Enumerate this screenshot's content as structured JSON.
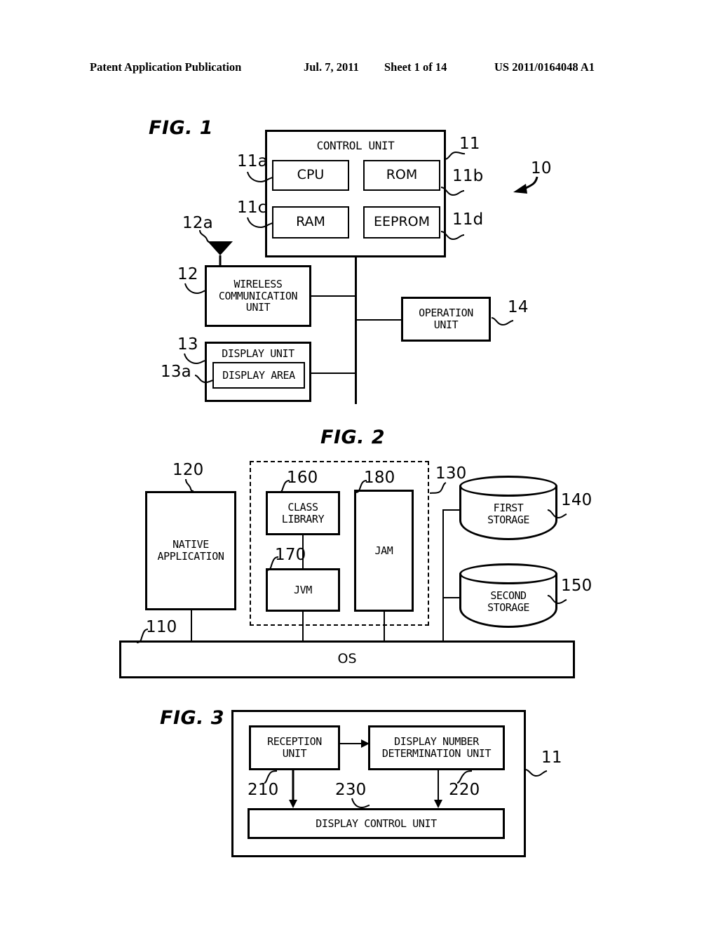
{
  "header": {
    "title": "Patent Application Publication",
    "date": "Jul. 7, 2011",
    "sheet": "Sheet 1 of 14",
    "patent_number": "US 2011/0164048 A1"
  },
  "figures": [
    {
      "label": "FIG. 1",
      "blocks": [
        {
          "id": "control-unit",
          "text": "CONTROL UNIT"
        },
        {
          "id": "cpu",
          "text": "CPU"
        },
        {
          "id": "rom",
          "text": "ROM"
        },
        {
          "id": "ram",
          "text": "RAM"
        },
        {
          "id": "eeprom",
          "text": "EEPROM"
        },
        {
          "id": "wireless-comm-unit",
          "text": "WIRELESS\nCOMMUNICATION\nUNIT"
        },
        {
          "id": "display-unit",
          "text": "DISPLAY UNIT"
        },
        {
          "id": "display-area",
          "text": "DISPLAY AREA"
        },
        {
          "id": "operation-unit",
          "text": "OPERATION\nUNIT"
        }
      ],
      "ref_numbers": [
        "11",
        "11a",
        "11b",
        "11c",
        "11d",
        "10",
        "12",
        "12a",
        "13",
        "13a",
        "14"
      ]
    },
    {
      "label": "FIG. 2",
      "blocks": [
        {
          "id": "native-application",
          "text": "NATIVE\nAPPLICATION"
        },
        {
          "id": "class-library",
          "text": "CLASS\nLIBRARY"
        },
        {
          "id": "jvm",
          "text": "JVM"
        },
        {
          "id": "jam",
          "text": "JAM"
        },
        {
          "id": "first-storage",
          "text": "FIRST\nSTORAGE"
        },
        {
          "id": "second-storage",
          "text": "SECOND\nSTORAGE"
        },
        {
          "id": "os",
          "text": "OS"
        }
      ],
      "ref_numbers": [
        "110",
        "120",
        "130",
        "140",
        "150",
        "160",
        "170",
        "180"
      ]
    },
    {
      "label": "FIG. 3",
      "blocks": [
        {
          "id": "reception-unit",
          "text": "RECEPTION\nUNIT"
        },
        {
          "id": "display-number-determination-unit",
          "text": "DISPLAY NUMBER\nDETERMINATION UNIT"
        },
        {
          "id": "display-control-unit",
          "text": "DISPLAY CONTROL UNIT"
        }
      ],
      "ref_numbers": [
        "11",
        "210",
        "220",
        "230"
      ]
    }
  ],
  "fig1": {
    "label": "FIG. 1",
    "control_unit": "CONTROL UNIT",
    "cpu": "CPU",
    "rom": "ROM",
    "ram": "RAM",
    "eeprom": "EEPROM",
    "wireless_line1": "WIRELESS",
    "wireless_line2": "COMMUNICATION",
    "wireless_line3": "UNIT",
    "display_unit": "DISPLAY UNIT",
    "display_area": "DISPLAY AREA",
    "operation_line1": "OPERATION",
    "operation_line2": "UNIT",
    "ref_10": "10",
    "ref_11": "11",
    "ref_11a": "11a",
    "ref_11b": "11b",
    "ref_11c": "11c",
    "ref_11d": "11d",
    "ref_12": "12",
    "ref_12a": "12a",
    "ref_13": "13",
    "ref_13a": "13a",
    "ref_14": "14"
  },
  "fig2": {
    "label": "FIG. 2",
    "native_line1": "NATIVE",
    "native_line2": "APPLICATION",
    "class_line1": "CLASS",
    "class_line2": "LIBRARY",
    "jvm": "JVM",
    "jam": "JAM",
    "first_line1": "FIRST",
    "first_line2": "STORAGE",
    "second_line1": "SECOND",
    "second_line2": "STORAGE",
    "os": "OS",
    "ref_110": "110",
    "ref_120": "120",
    "ref_130": "130",
    "ref_140": "140",
    "ref_150": "150",
    "ref_160": "160",
    "ref_170": "170",
    "ref_180": "180"
  },
  "fig3": {
    "label": "FIG. 3",
    "reception_line1": "RECEPTION",
    "reception_line2": "UNIT",
    "determination_line1": "DISPLAY NUMBER",
    "determination_line2": "DETERMINATION UNIT",
    "display_control": "DISPLAY CONTROL UNIT",
    "ref_11": "11",
    "ref_210": "210",
    "ref_220": "220",
    "ref_230": "230"
  }
}
